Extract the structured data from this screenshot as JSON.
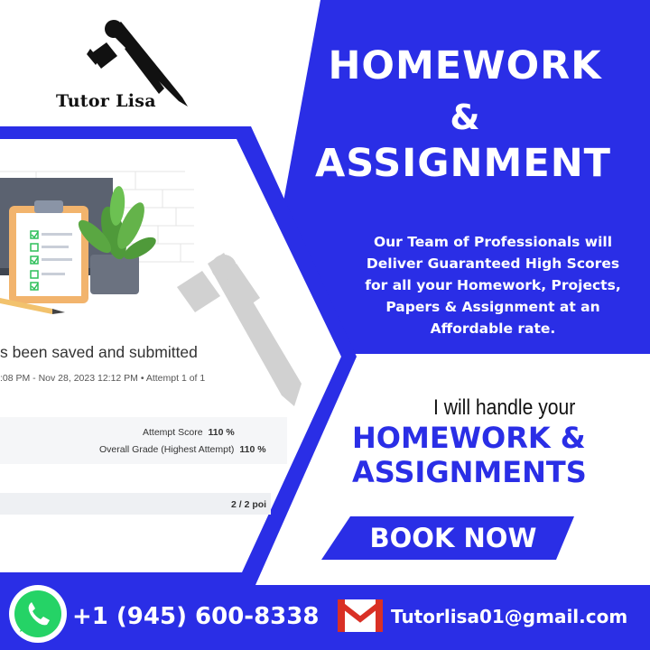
{
  "colors": {
    "brand_blue": "#2a2ee6",
    "white": "#ffffff",
    "dark": "#111111"
  },
  "logo": {
    "name": "Tutor Lisa",
    "icon": "pen-pencil-icon"
  },
  "headline": {
    "line1": "HOMEWORK",
    "line2": "&",
    "line3": "ASSIGNMENT"
  },
  "description": {
    "lines": [
      "Our Team of Professionals will",
      "Deliver Guaranteed High Scores",
      "for all your Homework, Projects,",
      "Papers & Assignment at an",
      "Affordable rate."
    ]
  },
  "tagline": {
    "lead": "I will handle your",
    "line1": "HOMEWORK &",
    "line2": "ASSIGNMENTS"
  },
  "cta": {
    "label": "BOOK NOW"
  },
  "screenshot": {
    "title": "s been saved and submitted",
    "meta": ":08 PM - Nov 28, 2023 12:12 PM  •  Attempt 1 of 1",
    "attempt_score_label": "Attempt Score",
    "attempt_score_value": "110 %",
    "overall_grade_label": "Overall Grade (Highest Attempt)",
    "overall_grade_value": "110 %",
    "points": "2 / 2 poi"
  },
  "contact": {
    "phone": "+1 (945) 600-8338",
    "email": "Tutorlisa01@gmail.com",
    "phone_icon": "whatsapp-icon",
    "email_icon": "gmail-icon"
  }
}
